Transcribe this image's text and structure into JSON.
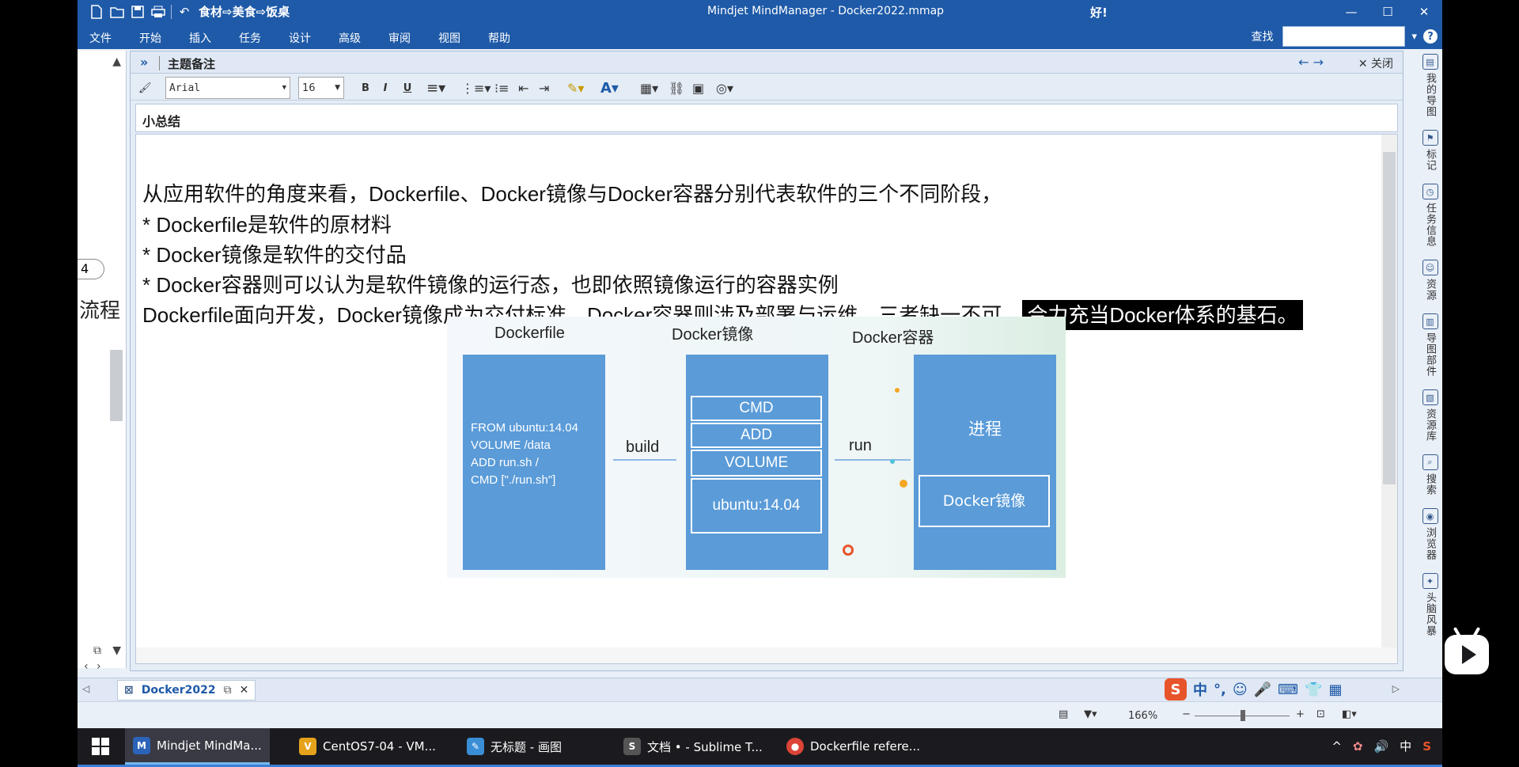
{
  "window": {
    "title": "Mindjet MindManager - Docker2022.mmap",
    "status_text": "好!",
    "breadcrumb": "食材⇨美食⇨饭桌"
  },
  "menu": {
    "items": [
      "文件",
      "开始",
      "插入",
      "任务",
      "设计",
      "高级",
      "审阅",
      "视图",
      "帮助"
    ],
    "find_label": "查找"
  },
  "left_pane": {
    "badge": "4",
    "fragment": "流程"
  },
  "notes": {
    "panel_title": "主题备注",
    "close_label": "关闭",
    "font": "Arial",
    "font_size": "16",
    "subject": "小总结",
    "lines": [
      "从应用软件的角度来看，Dockerfile、Docker镜像与Docker容器分别代表软件的三个不同阶段，",
      "*  Dockerfile是软件的原材料",
      "*  Docker镜像是软件的交付品",
      "*  Docker容器则可以认为是软件镜像的运行态，也即依照镜像运行的容器实例"
    ],
    "last_line": "Dockerfile面向开发，Docker镜像成为交付标准，Docker容器则涉及部署与运维，三者缺一不可，",
    "last_line_highlight": "合力充当Docker体系的基石。"
  },
  "diagram": {
    "col1_title": "Dockerfile",
    "col2_title": "Docker镜像",
    "col3_title": "Docker容器",
    "dockerfile_lines": [
      "FROM ubuntu:14.04",
      "VOLUME /data",
      "ADD run.sh /",
      "CMD [\"./run.sh\"]"
    ],
    "build_label": "build",
    "run_label": "run",
    "image_layers": [
      "CMD",
      "ADD",
      "VOLUME",
      "ubuntu:14.04"
    ],
    "process_label": "进程",
    "container_image_label": "Docker镜像"
  },
  "right_panel": {
    "items": [
      "我的导图",
      "标记",
      "任务信息",
      "资源",
      "导图部件",
      "资源库",
      "搜索",
      "浏览器",
      "头脑风暴"
    ]
  },
  "tabs": {
    "document": "Docker2022"
  },
  "status": {
    "zoom": "166%"
  },
  "taskbar": {
    "tasks": [
      "Mindjet MindMa...",
      "CentOS7-04 - VM...",
      "无标题 - 画图",
      "文档 • - Sublime T...",
      "Dockerfile refere..."
    ],
    "tray_lang": "中"
  },
  "colors": {
    "title_bar": "#1e5aa8",
    "diagram_blue": "#5a9bd8",
    "highlight_bg": "#000000"
  }
}
